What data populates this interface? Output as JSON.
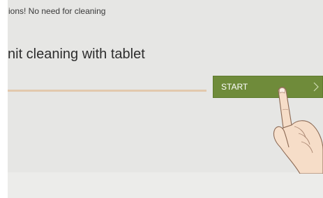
{
  "status": {
    "text": "ions! No need for cleaning"
  },
  "prompt": {
    "title": "nit cleaning with tablet"
  },
  "start_button": {
    "label": "START",
    "icon": "chevron-right-icon",
    "color": "#6f8b3a"
  },
  "hint": {
    "icon": "pointing-hand-icon"
  }
}
